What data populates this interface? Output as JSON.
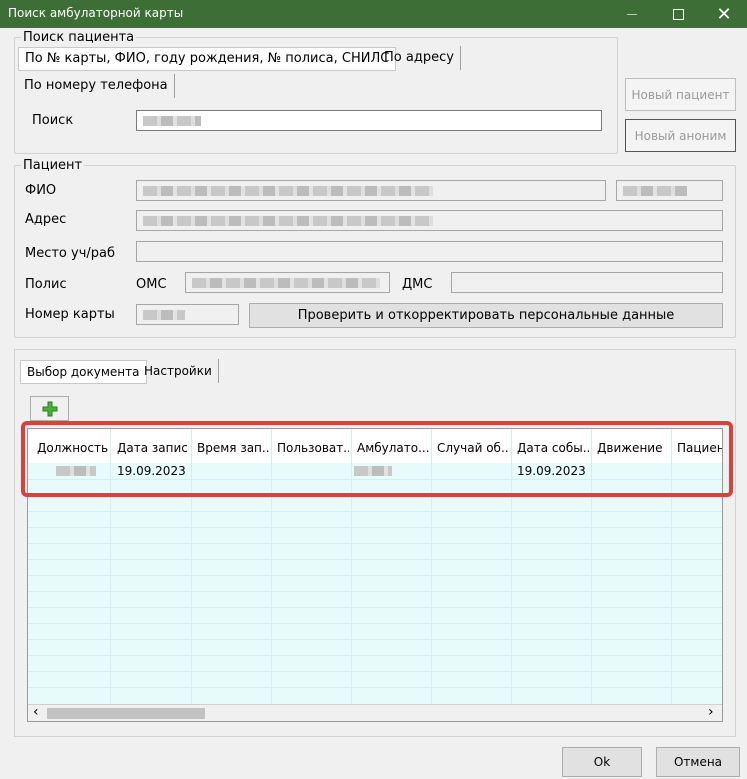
{
  "window": {
    "title": "Поиск амбулаторной карты",
    "minimize_icon": "minimize-icon",
    "maximize_icon": "maximize-icon",
    "close_glyph": "✕"
  },
  "search": {
    "legend": "Поиск пациента",
    "tabs": [
      {
        "label": "По № карты, ФИО, году рождения, № полиса, СНИЛС"
      },
      {
        "label": "По адресу"
      },
      {
        "label": "По номеру телефона"
      }
    ],
    "search_label": "Поиск",
    "new_patient_label": "Новый пациент",
    "new_anon_label": "Новый аноним"
  },
  "patient": {
    "legend": "Пациент",
    "fio_label": "ФИО",
    "address_label": "Адрес",
    "work_label": "Место уч/раб",
    "policy_label": "Полис",
    "oms_label": "ОМС",
    "dms_label": "ДМС",
    "card_label": "Номер карты",
    "check_button": "Проверить и откорректировать персональные данные"
  },
  "doc_tabs": [
    {
      "label": "Выбор документа"
    },
    {
      "label": "Настройки"
    }
  ],
  "toolbar": {
    "add_icon": "plus-icon"
  },
  "grid": {
    "columns": [
      "Должность",
      "Дата записи",
      "Время зап...",
      "Пользоват...",
      "Амбулато...",
      "Случай об...",
      "Дата собы...",
      "Движение",
      "Пациен"
    ],
    "rows": [
      {
        "date_record": "19.09.2023",
        "date_event": "19.09.2023"
      }
    ],
    "scroll_left_glyph": "‹",
    "scroll_right_glyph": "›"
  },
  "footer": {
    "ok_label": "Ok",
    "cancel_label": "Отмена"
  },
  "colors": {
    "titlebar": "#3d6e35",
    "highlight": "#d9413a",
    "grid_bg": "#e7fbfb"
  }
}
